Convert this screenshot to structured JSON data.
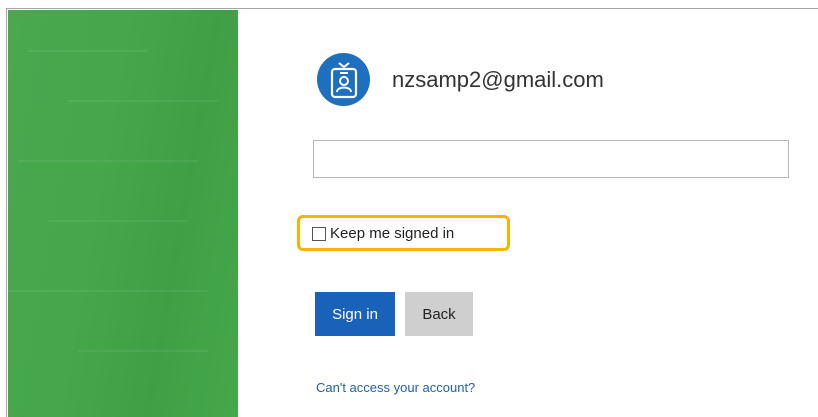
{
  "account": {
    "email": "nzsamp2@gmail.com",
    "avatar_icon": "id-badge-icon",
    "avatar_color": "#1f6fbf"
  },
  "password": {
    "value": "",
    "placeholder": ""
  },
  "keep_signed_in": {
    "label": "Keep me signed in",
    "checked": false
  },
  "actions": {
    "sign_in_label": "Sign in",
    "back_label": "Back",
    "cant_access_label": "Can't access your account?"
  },
  "colors": {
    "brand_green": "#45a64b",
    "primary_button": "#1a62b9",
    "secondary_button": "#cfcfcf",
    "link": "#1f5fb5",
    "highlight": "#f4b400"
  }
}
